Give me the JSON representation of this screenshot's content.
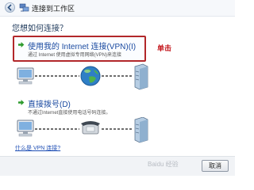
{
  "window": {
    "title": "连接到工作区"
  },
  "question": "您想如何连接？",
  "options": [
    {
      "title": "使用我的 Internet 连接(VPN)(I)",
      "description": "通过 Internet 使用虚拟专用网络(VPN)来连接"
    },
    {
      "title": "直接拨号(D)",
      "description": "不通过Internet直接使用电话号码连接。"
    }
  ],
  "annotation": "单击",
  "help_link": "什么是 VPN 连接?",
  "footer": {
    "watermark": "Baidu 经验",
    "cancel_label": "取消"
  },
  "colors": {
    "highlight_border": "#b2272a",
    "annotation": "#c4161c",
    "link": "#1f4fb5",
    "arrow": "#2e9b2e"
  },
  "icons": [
    "back-arrow-icon",
    "network-icon",
    "green-arrow-icon",
    "computer-icon",
    "globe-icon",
    "server-icon",
    "phone-icon"
  ]
}
